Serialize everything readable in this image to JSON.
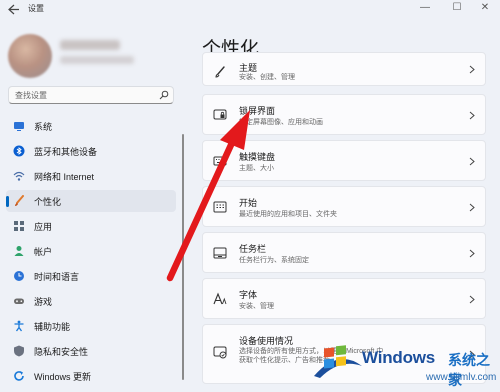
{
  "window": {
    "title": "设置",
    "controls": {
      "minimize": "—",
      "maximize": "☐",
      "close": "✕"
    }
  },
  "search": {
    "placeholder": "查找设置"
  },
  "sidebar": {
    "items": [
      {
        "label": "系统",
        "icon": "monitor-icon",
        "color": "#2b72d6"
      },
      {
        "label": "蓝牙和其他设备",
        "icon": "bluetooth-icon",
        "color": "#0a5fd1"
      },
      {
        "label": "网络和 Internet",
        "icon": "wifi-icon",
        "color": "#4a6ea8"
      },
      {
        "label": "个性化",
        "icon": "brush-icon",
        "color": "#e07a2e",
        "active": true
      },
      {
        "label": "应用",
        "icon": "apps-icon",
        "color": "#5a6a7a"
      },
      {
        "label": "帐户",
        "icon": "person-icon",
        "color": "#2fa36b"
      },
      {
        "label": "时间和语言",
        "icon": "globe-clock-icon",
        "color": "#2b72d6"
      },
      {
        "label": "游戏",
        "icon": "gamepad-icon",
        "color": "#6b6b6b"
      },
      {
        "label": "辅助功能",
        "icon": "accessibility-icon",
        "color": "#1a7ad9"
      },
      {
        "label": "隐私和安全性",
        "icon": "shield-icon",
        "color": "#6b7280"
      },
      {
        "label": "Windows 更新",
        "icon": "update-icon",
        "color": "#1a7ad9"
      }
    ]
  },
  "main": {
    "title": "个性化",
    "cards": [
      {
        "title": "主题",
        "subtitle": "安装、创建、管理",
        "icon": "brush-icon"
      },
      {
        "title": "锁屏界面",
        "subtitle": "锁定屏幕图像、应用和动画",
        "icon": "lock-screen-icon"
      },
      {
        "title": "触摸键盘",
        "subtitle": "主题、大小",
        "icon": "keyboard-icon"
      },
      {
        "title": "开始",
        "subtitle": "最近使用的应用和项目、文件夹",
        "icon": "start-icon"
      },
      {
        "title": "任务栏",
        "subtitle": "任务栏行为、系统固定",
        "icon": "taskbar-icon"
      },
      {
        "title": "字体",
        "subtitle": "安装、管理",
        "icon": "font-icon"
      },
      {
        "title": "设备使用情况",
        "subtitle": "选择设备的所有使用方式，以便在 Microsoft 中获取个性化提示、广告和推荐",
        "icon": "device-usage-icon"
      }
    ]
  },
  "watermark": {
    "brand": "Windows",
    "cn": "系统之家",
    "url": "www.bjjmlv.com"
  },
  "colors": {
    "accent": "#0067c0",
    "arrow": "#e3191c"
  }
}
